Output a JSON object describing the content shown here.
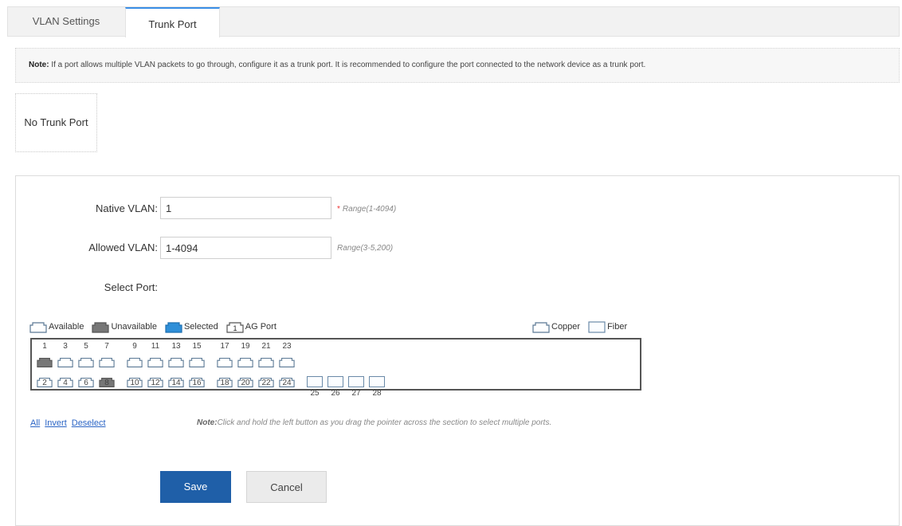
{
  "tabs": [
    {
      "label": "VLAN Settings",
      "active": false
    },
    {
      "label": "Trunk Port",
      "active": true
    }
  ],
  "note": {
    "prefix": "Note:",
    "text": " If a port allows multiple VLAN packets to go through, configure it as a trunk port. It is recommended to configure the port connected to the network device as a trunk port."
  },
  "trunk_status": "No Trunk Port",
  "form": {
    "native_vlan": {
      "label": "Native VLAN:",
      "value": "1",
      "required_mark": "*",
      "hint": "Range(1-4094)"
    },
    "allowed_vlan": {
      "label": "Allowed VLAN:",
      "value": "1-4094",
      "hint": "Range(3-5,200)"
    },
    "select_port_label": "Select Port:"
  },
  "legend": {
    "available": "Available",
    "unavailable": "Unavailable",
    "selected": "Selected",
    "ag_port": "AG Port",
    "ag_port_number": "1",
    "copper": "Copper",
    "fiber": "Fiber"
  },
  "colors": {
    "available": "#ffffff",
    "unavailable": "#777777",
    "selected": "#2f8fd8",
    "port_outline": "#5a7894",
    "accent": "#1f5fa8"
  },
  "ports": {
    "odd_numbers": [
      "1",
      "3",
      "5",
      "7",
      "9",
      "11",
      "13",
      "15",
      "17",
      "19",
      "21",
      "23"
    ],
    "even_numbers": [
      "2",
      "4",
      "6",
      "8",
      "10",
      "12",
      "14",
      "16",
      "18",
      "20",
      "22",
      "24"
    ],
    "fiber_numbers": [
      "25",
      "26",
      "27",
      "28"
    ],
    "unavailable": [
      "1",
      "8"
    ]
  },
  "links": {
    "all": "All",
    "invert": "Invert",
    "deselect": "Deselect"
  },
  "drag_note": {
    "prefix": "Note:",
    "text": "Click and hold the left button as you drag the pointer across the section to select multiple ports."
  },
  "buttons": {
    "save": "Save",
    "cancel": "Cancel"
  }
}
